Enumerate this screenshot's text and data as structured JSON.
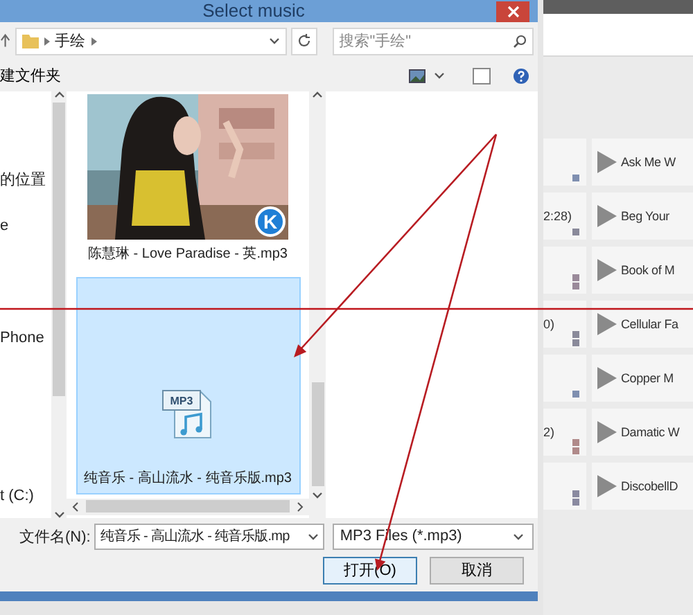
{
  "dialog": {
    "title": "Select music",
    "address": {
      "breadcrumb": [
        "手绘"
      ],
      "search": {
        "placeholder": "搜索\"手绘\""
      }
    },
    "toolbar": {
      "new_folder": "建文件夹"
    },
    "nav": {
      "items": [
        {
          "label": "的位置"
        },
        {
          "label": "e"
        },
        {
          "label": "Phone"
        },
        {
          "label": "t (C:)"
        }
      ]
    },
    "files": [
      {
        "name": "陈慧琳 - Love Paradise - 英.mp3",
        "kind": "picture",
        "badge": "K",
        "selected": false
      },
      {
        "name": "纯音乐 - 高山流水 - 纯音乐版.mp3",
        "kind": "mp3",
        "icon_label": "MP3",
        "selected": true
      }
    ],
    "filename": {
      "label": "文件名(N):",
      "value": "纯音乐 - 高山流水 - 纯音乐版.mp"
    },
    "filter": {
      "value": "MP3 Files (*.mp3)"
    },
    "buttons": [
      {
        "label": "打开(O)",
        "kind": "default"
      },
      {
        "label": "取消",
        "kind": "normal"
      }
    ]
  },
  "background_app": {
    "rows": [
      {
        "title": "Ask Me W",
        "kind": "single",
        "color": "#7f8fb0"
      },
      {
        "info": "2:28)",
        "title": "Beg Your",
        "kind": "single",
        "color": "#8a8a9a"
      },
      {
        "title": "Book of M",
        "kind": "double",
        "color": "#9a8a9a"
      },
      {
        "info": "0)",
        "title": "Cellular Fa",
        "kind": "double",
        "color": "#8a8a9a"
      },
      {
        "title": "Copper M",
        "kind": "single",
        "color": "#7f8fb0"
      },
      {
        "info": "2)",
        "title": "Damatic W",
        "kind": "double",
        "color": "#b08a8a"
      },
      {
        "title": "DiscobellD",
        "kind": "double",
        "color": "#8a8aa0"
      }
    ]
  }
}
